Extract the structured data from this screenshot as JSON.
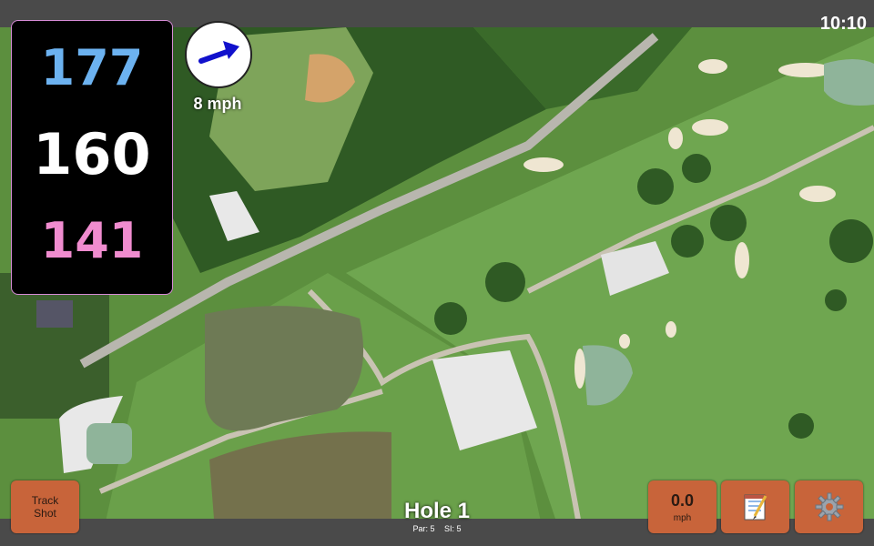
{
  "status": {
    "time": "10:10"
  },
  "distances": {
    "back": "177",
    "center": "160",
    "front": "141",
    "colors": {
      "back": "#6cb2f0",
      "center": "#ffffff",
      "front": "#f08ccf"
    }
  },
  "wind": {
    "speed_label": "8 mph",
    "arrow_icon": "wind-arrow-icon",
    "arrow_color": "#1111cc",
    "speed_color": "#ffffff"
  },
  "buttons": {
    "track_shot": "Track\nShot",
    "speed_value": "0.0",
    "speed_unit": "mph",
    "notes_icon": "notepad-icon",
    "settings_icon": "gear-icon",
    "accent": "#c8643a"
  },
  "hole": {
    "title": "Hole 1",
    "par": "Par: 5",
    "si": "SI: 5"
  },
  "map": {
    "theme": "satellite-golf-course"
  }
}
